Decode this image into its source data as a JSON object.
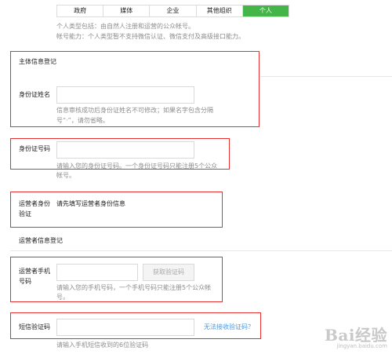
{
  "account_types": {
    "tabs": [
      "政府",
      "媒体",
      "企业",
      "其他组织",
      "个人"
    ],
    "active_index": 4,
    "notes": [
      "个人类型包括：由自然人注册和运营的公众帐号。",
      "帐号能力：个人类型暂不支持微信认证、微信支付及高级接口能力。"
    ]
  },
  "subject_info": {
    "section_title": "主体信息登记",
    "id_name": {
      "label": "身份证姓名",
      "value": "",
      "hint_line1": "信息审核成功后身份证姓名不可修改；如果名字包含分隔",
      "hint_line2": "号“·”，请勿省略。"
    },
    "id_number": {
      "label": "身份证号码",
      "value": "",
      "hint_line1": "请输入您的身份证号码。一个身份证号码只能注册5个公众",
      "hint_line2": "帐号。"
    },
    "operator_verify": {
      "label_line1": "运营者身份",
      "label_line2": "验证",
      "text": "请先填写运营者身份信息"
    }
  },
  "operator_info": {
    "section_title": "运营者信息登记",
    "phone": {
      "label_line1": "运营者手机",
      "label_line2": "号码",
      "value": "",
      "button": "获取验证码",
      "hint_line1": "请输入您的手机号码，一个手机号码只能注册5个公众帐",
      "hint_line2": "号。"
    },
    "sms_code": {
      "label": "短信验证码",
      "value": "",
      "link": "无法接收验证码？",
      "hint": "请输入手机短信收到的6位验证码"
    }
  },
  "watermark": {
    "logo": "Bai经验",
    "url": "jingyan.baidu.com"
  },
  "colors": {
    "highlight_box": "#e8302f",
    "active_tab": "#44b549",
    "link": "#459ae9",
    "hint": "#8d8d8d"
  }
}
